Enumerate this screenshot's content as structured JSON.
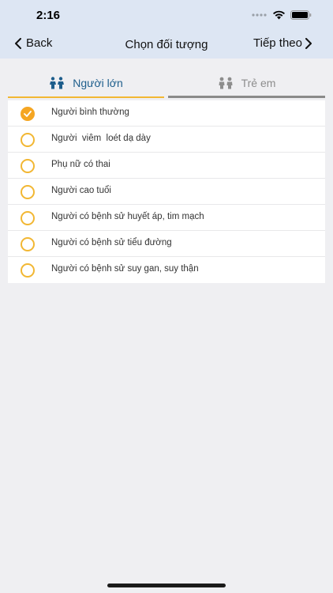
{
  "status": {
    "time": "2:16"
  },
  "nav": {
    "back_label": "Back",
    "title": "Chọn đối tượng",
    "next_label": "Tiếp theo"
  },
  "tabs": [
    {
      "label": "Người lớn",
      "icon": "adults-icon",
      "active": true
    },
    {
      "label": "Trẻ em",
      "icon": "children-icon",
      "active": false
    }
  ],
  "options": [
    {
      "label": "Người bình thường",
      "checked": true
    },
    {
      "label": "Người  viêm  loét dạ dày",
      "checked": false
    },
    {
      "label": "Phụ nữ có thai",
      "checked": false
    },
    {
      "label": "Người cao tuổi",
      "checked": false
    },
    {
      "label": "Người có bệnh sử huyết áp, tim mạch",
      "checked": false
    },
    {
      "label": "Người có bệnh sử tiểu đường",
      "checked": false
    },
    {
      "label": "Người có bệnh sử suy gan, suy thận",
      "checked": false
    }
  ],
  "colors": {
    "accent": "#F5A623",
    "active_tab": "#1E5E8C",
    "header_bg": "#DDE6F3"
  }
}
